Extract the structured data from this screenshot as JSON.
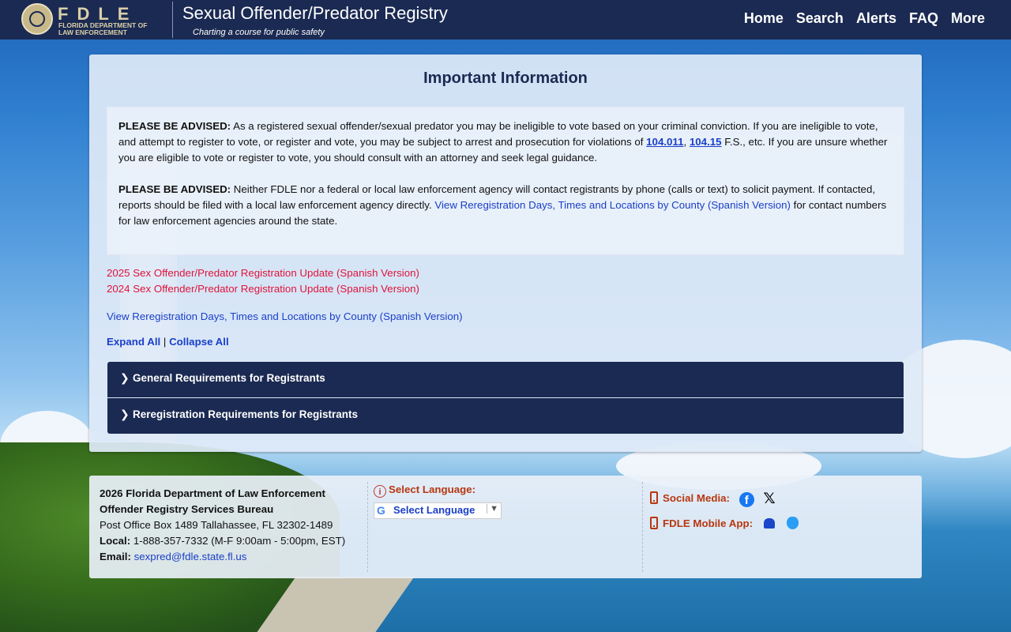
{
  "header": {
    "logo_word": "FDLE",
    "logo_sub_line1": "FLORIDA DEPARTMENT OF",
    "logo_sub_line2": "LAW ENFORCEMENT",
    "title": "Sexual Offender/Predator Registry",
    "tagline": "Charting a course for public safety",
    "nav": [
      "Home",
      "Search",
      "Alerts",
      "FAQ",
      "More"
    ]
  },
  "main": {
    "title": "Important Information",
    "notice1": {
      "lead": "PLEASE BE ADVISED:",
      "text_a": " As a registered sexual offender/sexual predator you may be ineligible to vote based on your criminal conviction. If you are ineligible to vote, and attempt to register to vote, or register and vote, you may be subject to arrest and prosecution for violations of ",
      "link1": "104.011",
      "sep": ", ",
      "link2": "104.15",
      "text_b": " F.S., etc. If you are unsure whether you are eligible to vote or register to vote, you should consult with an attorney and seek legal guidance."
    },
    "notice2": {
      "lead": "PLEASE BE ADVISED:",
      "text_a": " Neither FDLE nor a federal or local law enforcement agency will contact registrants by phone (calls or text) to solicit payment. If contacted, reports should be filed with a local law enforcement agency directly. ",
      "link": "View Reregistration Days, Times and Locations by County (Spanish Version)",
      "text_b": " for contact numbers for law enforcement agencies around the state."
    },
    "red_links": [
      "2025 Sex Offender/Predator Registration Update (Spanish Version)",
      "2024 Sex Offender/Predator Registration Update (Spanish Version)"
    ],
    "rereg_link": "View Reregistration Days, Times and Locations by County (Spanish Version)",
    "expand_all": "Expand All",
    "pipe": " | ",
    "collapse_all": "Collapse All",
    "accordions": [
      "General Requirements for Registrants",
      "Reregistration Requirements for Registrants"
    ]
  },
  "footer": {
    "org_line": "2026 Florida Department of Law Enforcement",
    "bureau": "Offender Registry Services Bureau",
    "address": "Post Office Box 1489 Tallahassee, FL 32302-1489",
    "local_label": "Local:",
    "local_value": " 1-888-357-7332 (M-F 9:00am - 5:00pm, EST)",
    "email_label": "Email:",
    "email_value": "sexpred@fdle.state.fl.us",
    "select_language_label": "Select Language:",
    "select_language_value": "Select Language",
    "social_label": "Social Media:",
    "mobile_label": "FDLE Mobile App:"
  },
  "colors": {
    "navy": "#1b2a52",
    "link_blue": "#1a3fc7",
    "link_red": "#e0133b",
    "accent_orange": "#b8370f"
  },
  "icons": [
    "info-icon",
    "phone-icon",
    "facebook-icon",
    "x-icon",
    "android-icon",
    "apple-icon",
    "chevron-right-icon",
    "google-icon",
    "dropdown-arrow-icon"
  ]
}
